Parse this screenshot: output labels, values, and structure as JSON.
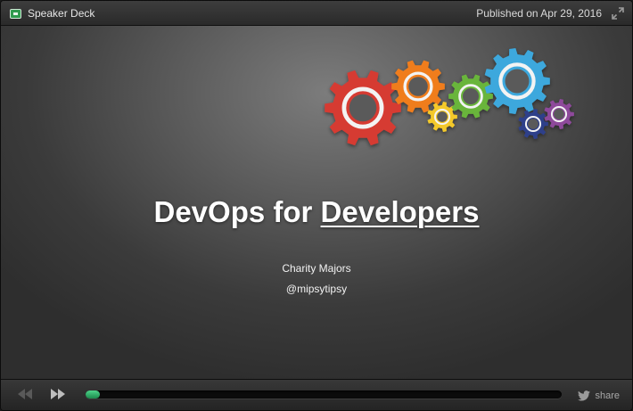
{
  "topbar": {
    "brand": "Speaker Deck",
    "published": "Published on Apr 29, 2016"
  },
  "slide": {
    "title_part1": "DevOps for ",
    "title_part2": "Developers",
    "author": "Charity Majors",
    "handle": "@mipsytipsy"
  },
  "controls": {
    "share_label": "share",
    "progress": 0.03
  },
  "colors": {
    "brand_green": "#2f9b4e",
    "progress_green": "#3dbb74",
    "gear_red": "#d63a33",
    "gear_orange": "#f07d1d",
    "gear_yellow": "#f4c929",
    "gear_green": "#69b53b",
    "gear_blue": "#3ca8dd",
    "gear_navy": "#2f3f8a",
    "gear_purple": "#8e4a9b"
  },
  "icons": [
    "speakerdeck-logo-icon",
    "expand-icon",
    "gears-graphic",
    "rewind-icon",
    "fast-forward-icon",
    "twitter-bird-icon"
  ]
}
